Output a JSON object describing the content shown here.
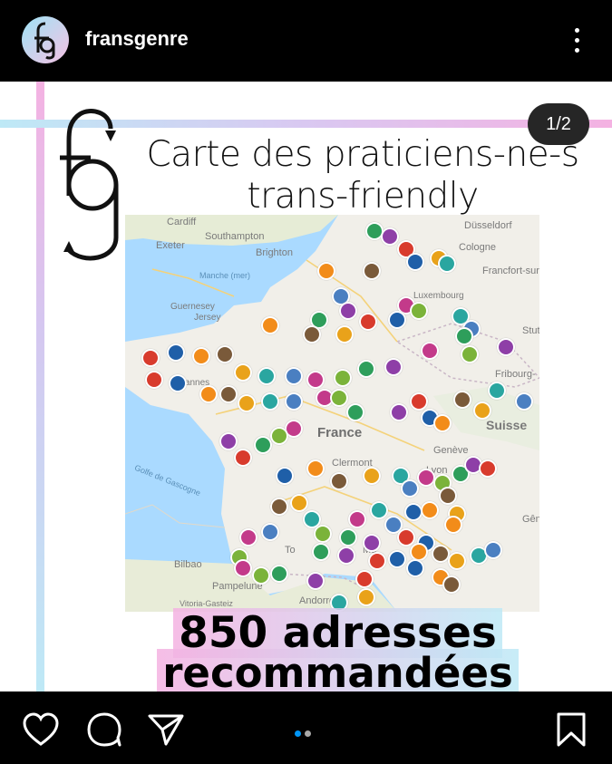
{
  "header": {
    "username": "fransgenre",
    "avatar_icon": "fg-logo-icon",
    "more_icon": "more-vertical-icon"
  },
  "post": {
    "counter": "1/2",
    "title_line1": "Carte des praticiens-ne-s",
    "title_line2": "trans-friendly",
    "tagline_line1": "850 adresses",
    "tagline_line2": "recommandées",
    "logo_icon": "fg-logo-icon",
    "accent_pink": "#f4b2e2",
    "accent_blue": "#bee9f6",
    "map": {
      "water_color": "#aadaff",
      "land_color": "#f1efe9",
      "labels": {
        "country": "France",
        "suisse": "Suisse",
        "cardiff": "Cardiff",
        "southampton": "Southampton",
        "exeter": "Exeter",
        "brighton": "Brighton",
        "manche": "Manche (mer)",
        "guernesey": "Guernesey",
        "jersey": "Jersey",
        "dusseldorf": "Düsseldorf",
        "cologne": "Cologne",
        "francfort": "Francfort-sur-",
        "luxembourg": "Luxembourg",
        "stuttgart": "Stut",
        "fribourg": "Fribourg-",
        "geneve": "Genève",
        "clermont": "Clermont",
        "golfe": "Golfe de Gascogne",
        "bilbao": "Bilbao",
        "pampelune": "Pampelune",
        "vitoria": "Vitoria-Gasteiz",
        "andorre": "Andorre",
        "genes": "Gên",
        "vannes": "Vannes",
        "toulouse": "To",
        "montpellier": "Mo",
        "lyon": "Lyon"
      }
    }
  },
  "footer": {
    "like_icon": "heart-icon",
    "comment_icon": "comment-icon",
    "share_icon": "send-icon",
    "save_icon": "bookmark-icon",
    "active_dot_color": "#0095f6",
    "inactive_dot_color": "#a8a8a8"
  }
}
